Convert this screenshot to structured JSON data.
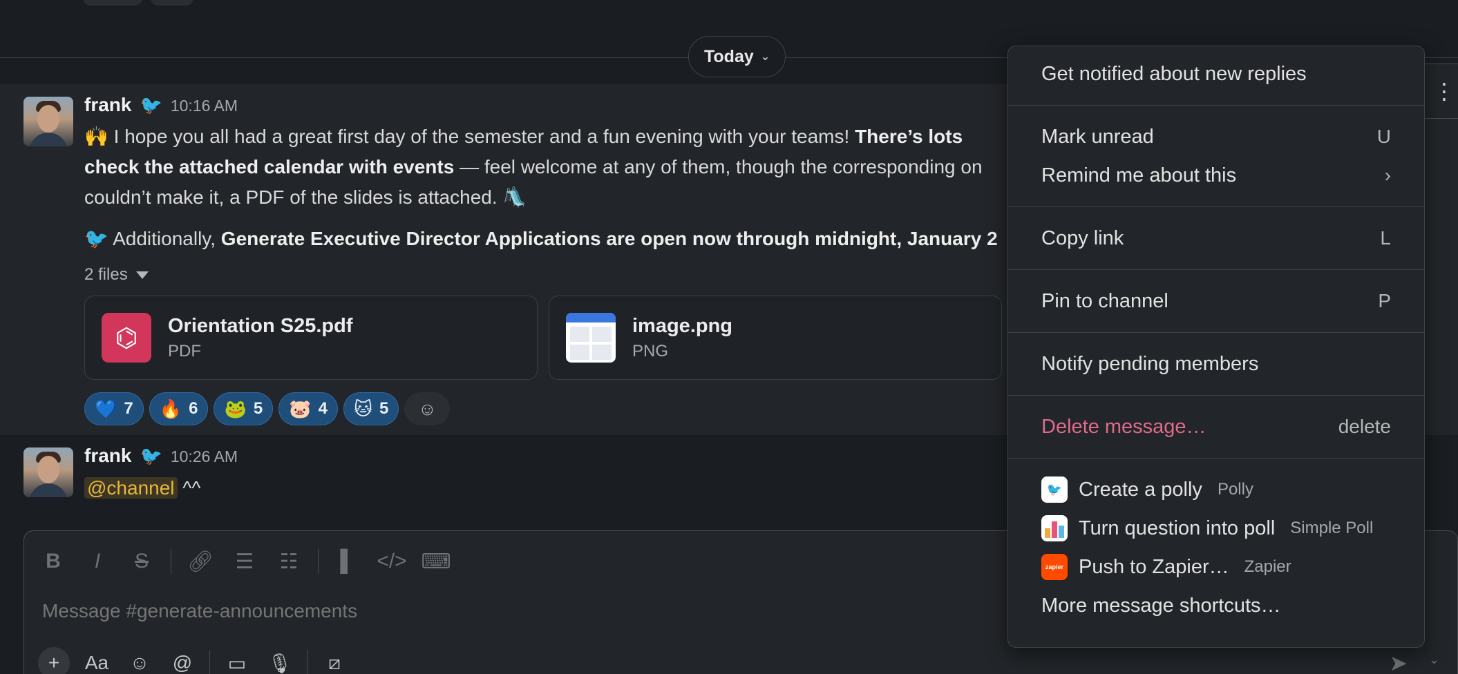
{
  "divider": {
    "label": "Today"
  },
  "messages": [
    {
      "author": "frank",
      "status_emoji": "🐦",
      "time": "10:16 AM",
      "line1_emoji": "🙌",
      "line1_text": " I hope you all had a great first day of the semester and a fun evening with your teams! ",
      "line1_bold": "There’s lots",
      "line2_bold": "check the attached calendar with events",
      "line2_text": " — feel welcome at any of them, though the corresponding on",
      "line3_text": "couldn’t make it, a PDF of the slides is attached. ",
      "line3_emoji": "🛝",
      "line4_emoji": "🐦",
      "line4_text": " Additionally, ",
      "line4_bold": "Generate Executive Director Applications are open now through midnight, January 2",
      "files_toggle": "2 files",
      "files": [
        {
          "name": "Orientation S25.pdf",
          "type": "PDF"
        },
        {
          "name": "image.png",
          "type": "PNG"
        }
      ],
      "reactions": [
        {
          "emoji": "💙",
          "count": "7"
        },
        {
          "emoji": "🔥",
          "count": "6"
        },
        {
          "emoji": "🐸",
          "count": "5"
        },
        {
          "emoji": "🐷",
          "count": "4"
        },
        {
          "emoji": "🐱",
          "count": "5"
        }
      ]
    },
    {
      "author": "frank",
      "status_emoji": "🐦",
      "time": "10:26 AM",
      "mention": "@channel",
      "text": " ^^"
    }
  ],
  "composer": {
    "placeholder": "Message #generate-announcements"
  },
  "menu": {
    "get_notified": "Get notified about new replies",
    "mark_unread": "Mark unread",
    "mark_unread_sc": "U",
    "remind": "Remind me about this",
    "remind_arrow": "›",
    "copy_link": "Copy link",
    "copy_link_sc": "L",
    "pin": "Pin to channel",
    "pin_sc": "P",
    "notify_pending": "Notify pending members",
    "delete": "Delete message…",
    "delete_sc": "delete",
    "apps": [
      {
        "label": "Create a polly",
        "app": "Polly"
      },
      {
        "label": "Turn question into poll",
        "app": "Simple Poll"
      },
      {
        "label": "Push to Zapier…",
        "app": "Zapier",
        "icon_text": "zapier"
      }
    ],
    "more": "More message shortcuts…"
  }
}
